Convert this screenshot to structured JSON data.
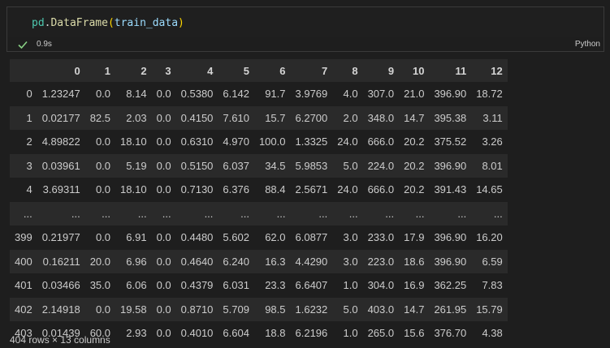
{
  "cell": {
    "code": {
      "var": "pd",
      "dot": ".",
      "func": "DataFrame",
      "open": "(",
      "arg": "train_data",
      "close": ")"
    },
    "exec_time": "0.9s",
    "language": "Python"
  },
  "dataframe": {
    "columns": [
      "",
      "0",
      "1",
      "2",
      "3",
      "4",
      "5",
      "6",
      "7",
      "8",
      "9",
      "10",
      "11",
      "12"
    ],
    "rows": [
      [
        "0",
        "1.23247",
        "0.0",
        "8.14",
        "0.0",
        "0.5380",
        "6.142",
        "91.7",
        "3.9769",
        "4.0",
        "307.0",
        "21.0",
        "396.90",
        "18.72"
      ],
      [
        "1",
        "0.02177",
        "82.5",
        "2.03",
        "0.0",
        "0.4150",
        "7.610",
        "15.7",
        "6.2700",
        "2.0",
        "348.0",
        "14.7",
        "395.38",
        "3.11"
      ],
      [
        "2",
        "4.89822",
        "0.0",
        "18.10",
        "0.0",
        "0.6310",
        "4.970",
        "100.0",
        "1.3325",
        "24.0",
        "666.0",
        "20.2",
        "375.52",
        "3.26"
      ],
      [
        "3",
        "0.03961",
        "0.0",
        "5.19",
        "0.0",
        "0.5150",
        "6.037",
        "34.5",
        "5.9853",
        "5.0",
        "224.0",
        "20.2",
        "396.90",
        "8.01"
      ],
      [
        "4",
        "3.69311",
        "0.0",
        "18.10",
        "0.0",
        "0.7130",
        "6.376",
        "88.4",
        "2.5671",
        "24.0",
        "666.0",
        "20.2",
        "391.43",
        "14.65"
      ],
      [
        "...",
        "...",
        "...",
        "...",
        "...",
        "...",
        "...",
        "...",
        "...",
        "...",
        "...",
        "...",
        "...",
        "..."
      ],
      [
        "399",
        "0.21977",
        "0.0",
        "6.91",
        "0.0",
        "0.4480",
        "5.602",
        "62.0",
        "6.0877",
        "3.0",
        "233.0",
        "17.9",
        "396.90",
        "16.20"
      ],
      [
        "400",
        "0.16211",
        "20.0",
        "6.96",
        "0.0",
        "0.4640",
        "6.240",
        "16.3",
        "4.4290",
        "3.0",
        "223.0",
        "18.6",
        "396.90",
        "6.59"
      ],
      [
        "401",
        "0.03466",
        "35.0",
        "6.06",
        "0.0",
        "0.4379",
        "6.031",
        "23.3",
        "6.6407",
        "1.0",
        "304.0",
        "16.9",
        "362.25",
        "7.83"
      ],
      [
        "402",
        "2.14918",
        "0.0",
        "19.58",
        "0.0",
        "0.8710",
        "5.709",
        "98.5",
        "1.6232",
        "5.0",
        "403.0",
        "14.7",
        "261.95",
        "15.79"
      ],
      [
        "403",
        "0.01439",
        "60.0",
        "2.93",
        "0.0",
        "0.4010",
        "6.604",
        "18.8",
        "6.2196",
        "1.0",
        "265.0",
        "15.6",
        "376.70",
        "4.38"
      ]
    ],
    "footer": "404 rows × 13 columns"
  },
  "icons": {
    "status": "check-icon"
  },
  "colors": {
    "success": "#89d185",
    "background": "#1e1e1e",
    "stripe": "#2a2a2a"
  }
}
